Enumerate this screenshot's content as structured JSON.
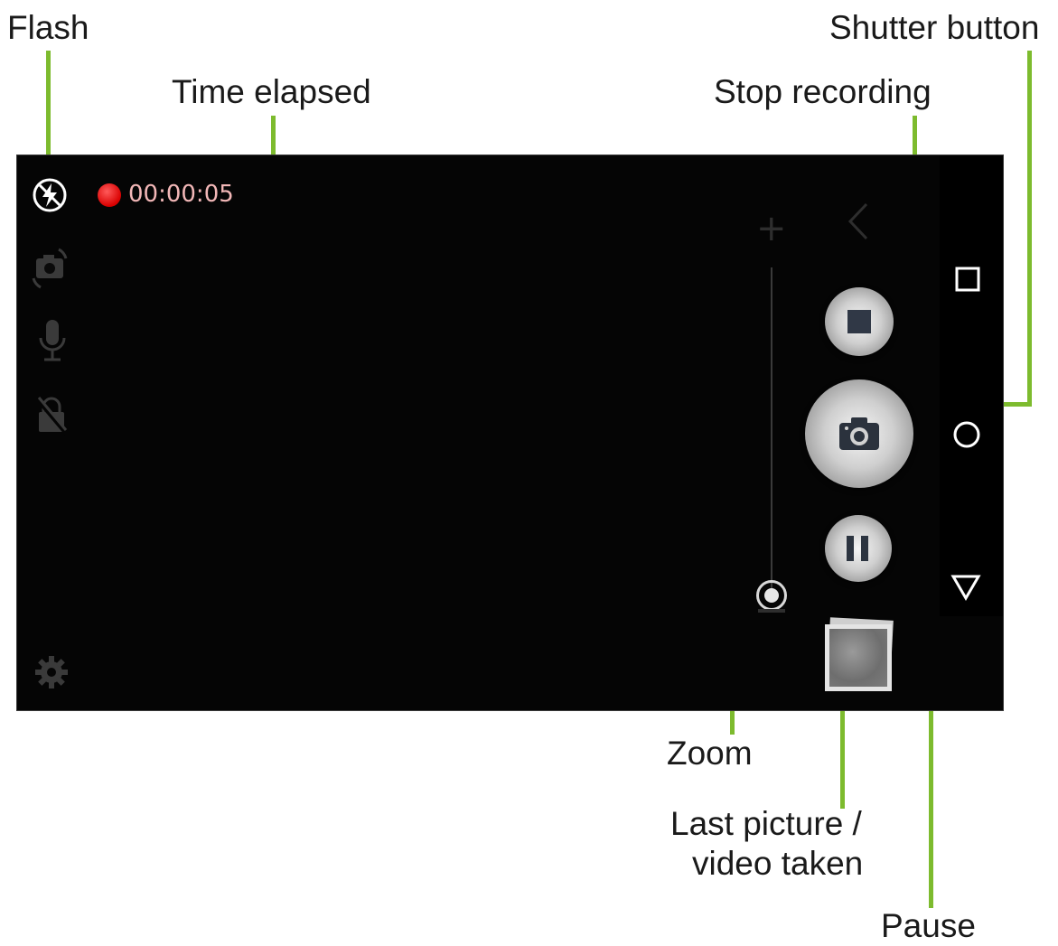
{
  "callouts": {
    "flash": "Flash",
    "time_elapsed": "Time elapsed",
    "stop_recording": "Stop recording",
    "shutter_button": "Shutter button",
    "zoom": "Zoom",
    "last_picture_line1": "Last picture /",
    "last_picture_line2": "video taken",
    "pause": "Pause"
  },
  "camera": {
    "recording_time": "00:00:05",
    "left_toolbar_icons": [
      "flash-off-icon",
      "switch-camera-icon",
      "microphone-icon",
      "lock-off-icon",
      "settings-gear-icon"
    ],
    "nav_icons": [
      "back-chevron-icon",
      "recent-apps-square-icon",
      "home-circle-icon",
      "notification-triangle-icon"
    ]
  },
  "colors": {
    "leader_line": "#7dbb2e",
    "recording_dot": "#e00000",
    "timer_text": "#f2b7b7",
    "screen_background": "#050505"
  }
}
